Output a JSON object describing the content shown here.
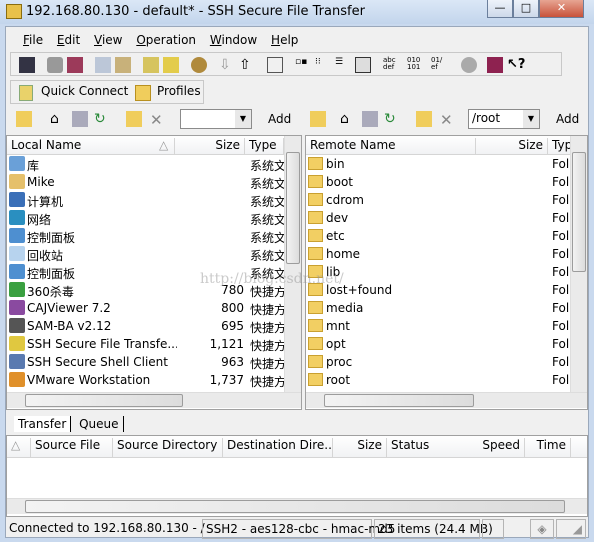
{
  "window": {
    "title": "192.168.80.130 - default* - SSH Secure File Transfer",
    "min": "—",
    "max": "□",
    "close": "✕"
  },
  "menu": [
    {
      "label": "File",
      "key": "F",
      "rest": "ile"
    },
    {
      "label": "Edit",
      "key": "E",
      "rest": "dit"
    },
    {
      "label": "View",
      "key": "V",
      "rest": "iew"
    },
    {
      "label": "Operation",
      "key": "O",
      "rest": "peration"
    },
    {
      "label": "Window",
      "key": "W",
      "rest": "indow"
    },
    {
      "label": "Help",
      "key": "H",
      "rest": "elp"
    }
  ],
  "toolbar2": {
    "quick_connect": "Quick Connect",
    "profiles": "Profiles"
  },
  "local_toolbar": {
    "path": "",
    "add": "Add"
  },
  "remote_toolbar": {
    "path": "/root",
    "add": "Add"
  },
  "local": {
    "columns": [
      "Local Name",
      "Size",
      "Type"
    ],
    "sort": "△",
    "rows": [
      {
        "name": "库",
        "size": "",
        "type": "系统文",
        "icon": "library-icon"
      },
      {
        "name": "Mike",
        "size": "",
        "type": "系统文",
        "icon": "user-folder-icon"
      },
      {
        "name": "计算机",
        "size": "",
        "type": "系统文",
        "icon": "computer-icon"
      },
      {
        "name": "网络",
        "size": "",
        "type": "系统文",
        "icon": "network-icon"
      },
      {
        "name": "控制面板",
        "size": "",
        "type": "系统文",
        "icon": "control-panel-icon"
      },
      {
        "name": "回收站",
        "size": "",
        "type": "系统文",
        "icon": "recycle-bin-icon"
      },
      {
        "name": "控制面板",
        "size": "",
        "type": "系统文",
        "icon": "control-panel-icon"
      },
      {
        "name": "360杀毒",
        "size": "780",
        "type": "快捷方",
        "icon": "antivirus-icon"
      },
      {
        "name": "CAJViewer 7.2",
        "size": "800",
        "type": "快捷方",
        "icon": "cajviewer-icon"
      },
      {
        "name": "SAM-BA v2.12",
        "size": "695",
        "type": "快捷方",
        "icon": "chip-icon"
      },
      {
        "name": "SSH Secure File Transfe...",
        "size": "1,121",
        "type": "快捷方",
        "icon": "ssh-transfer-icon"
      },
      {
        "name": "SSH Secure Shell Client",
        "size": "963",
        "type": "快捷方",
        "icon": "ssh-shell-icon"
      },
      {
        "name": "VMware Workstation",
        "size": "1,737",
        "type": "快捷方",
        "icon": "vmware-icon"
      }
    ]
  },
  "remote": {
    "columns": [
      "Remote Name",
      "Size",
      "Typ"
    ],
    "rows": [
      {
        "name": "bin",
        "type": "Fol"
      },
      {
        "name": "boot",
        "type": "Fol"
      },
      {
        "name": "cdrom",
        "type": "Fol"
      },
      {
        "name": "dev",
        "type": "Fol"
      },
      {
        "name": "etc",
        "type": "Fol"
      },
      {
        "name": "home",
        "type": "Fol"
      },
      {
        "name": "lib",
        "type": "Fol"
      },
      {
        "name": "lost+found",
        "type": "Fol"
      },
      {
        "name": "media",
        "type": "Fol"
      },
      {
        "name": "mnt",
        "type": "Fol"
      },
      {
        "name": "opt",
        "type": "Fol"
      },
      {
        "name": "proc",
        "type": "Fol"
      },
      {
        "name": "root",
        "type": "Fol"
      }
    ]
  },
  "transfer": {
    "tabs": [
      "Transfer",
      "Queue"
    ],
    "columns": [
      "△",
      "Source File",
      "Source Directory",
      "Destination Dire...",
      "Size",
      "Status",
      "Speed",
      "Time"
    ]
  },
  "status": {
    "connection": "Connected to 192.168.80.130 - /",
    "cipher": "SSH2 - aes128-cbc - hmac-md5",
    "items": "23 items (24.4 MB)"
  },
  "watermark": "http://blog.csdn.net/"
}
